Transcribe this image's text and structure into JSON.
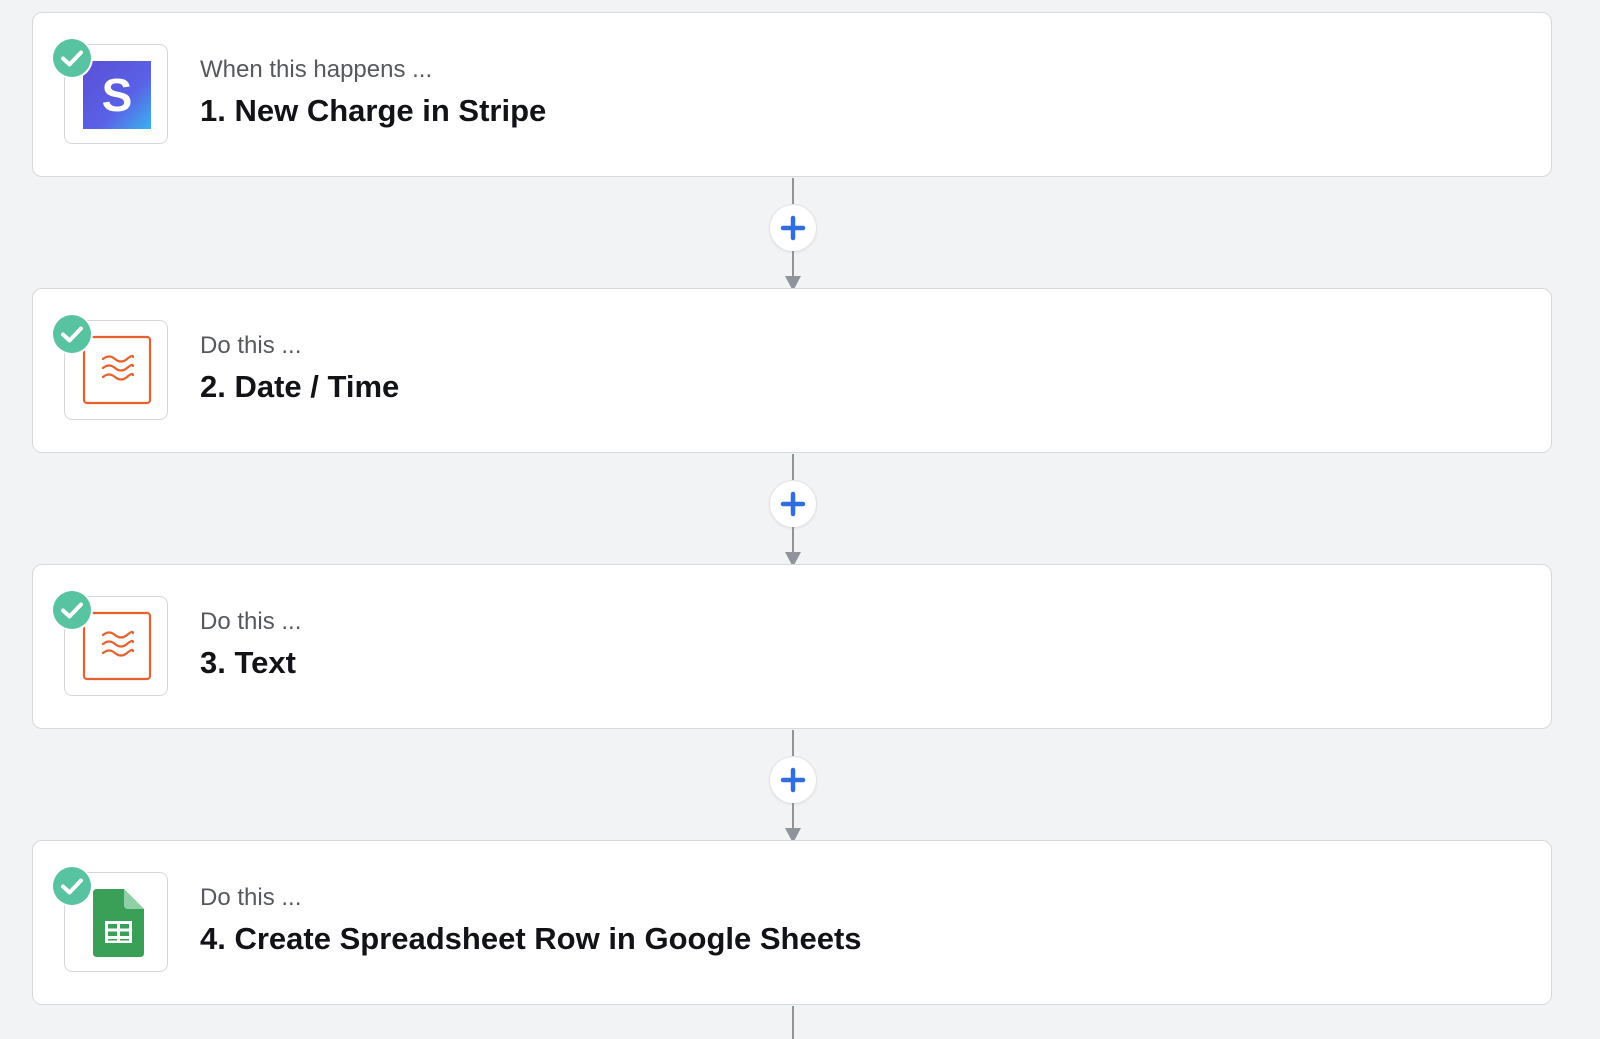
{
  "steps": [
    {
      "kicker": "When this happens ...",
      "title": "1. New Charge in Stripe",
      "app": "stripe",
      "icon": "stripe-logo-icon",
      "status_icon": "check-circle-icon"
    },
    {
      "kicker": "Do this ...",
      "title": "2. Date / Time",
      "app": "formatter",
      "icon": "formatter-logo-icon",
      "status_icon": "check-circle-icon"
    },
    {
      "kicker": "Do this ...",
      "title": "3. Text",
      "app": "formatter",
      "icon": "formatter-logo-icon",
      "status_icon": "check-circle-icon"
    },
    {
      "kicker": "Do this ...",
      "title": "4. Create Spreadsheet Row in Google Sheets",
      "app": "google-sheets",
      "icon": "google-sheets-logo-icon",
      "status_icon": "check-circle-icon"
    }
  ],
  "add_step_icon": "plus-icon",
  "colors": {
    "background": "#f2f3f5",
    "card": "#ffffff",
    "check_badge": "#57c3a0",
    "plus": "#2f6ee0",
    "connector": "#8f939a",
    "stripe": "#635bff",
    "formatter": "#e8602c",
    "sheets": "#34a853"
  }
}
